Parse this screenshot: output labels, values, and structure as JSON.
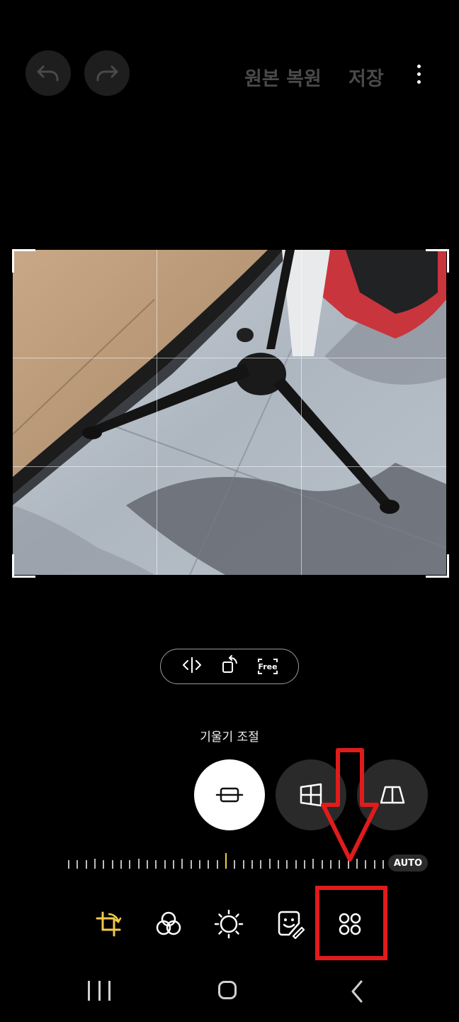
{
  "header": {
    "undo_icon": "undo-icon",
    "redo_icon": "redo-icon",
    "revert_label": "원본 복원",
    "save_label": "저장",
    "more_icon": "more-vert-icon"
  },
  "transform_pill": {
    "flip_icon": "flip-horizontal-icon",
    "rotate_icon": "rotate-icon",
    "aspect_label": "Free"
  },
  "adjust": {
    "title": "기울기 조절",
    "modes": [
      "straighten-icon",
      "vertical-perspective-icon",
      "horizontal-perspective-icon"
    ],
    "auto_label": "AUTO"
  },
  "toolbar": {
    "tools": [
      "crop-rotate-icon",
      "filters-icon",
      "brightness-icon",
      "sticker-icon",
      "more-tools-icon"
    ],
    "accent": "#f2c94c"
  },
  "annotation": {
    "color": "#e01b1b"
  },
  "navbar": {
    "items": [
      "recent-apps-icon",
      "home-icon",
      "back-icon"
    ]
  }
}
